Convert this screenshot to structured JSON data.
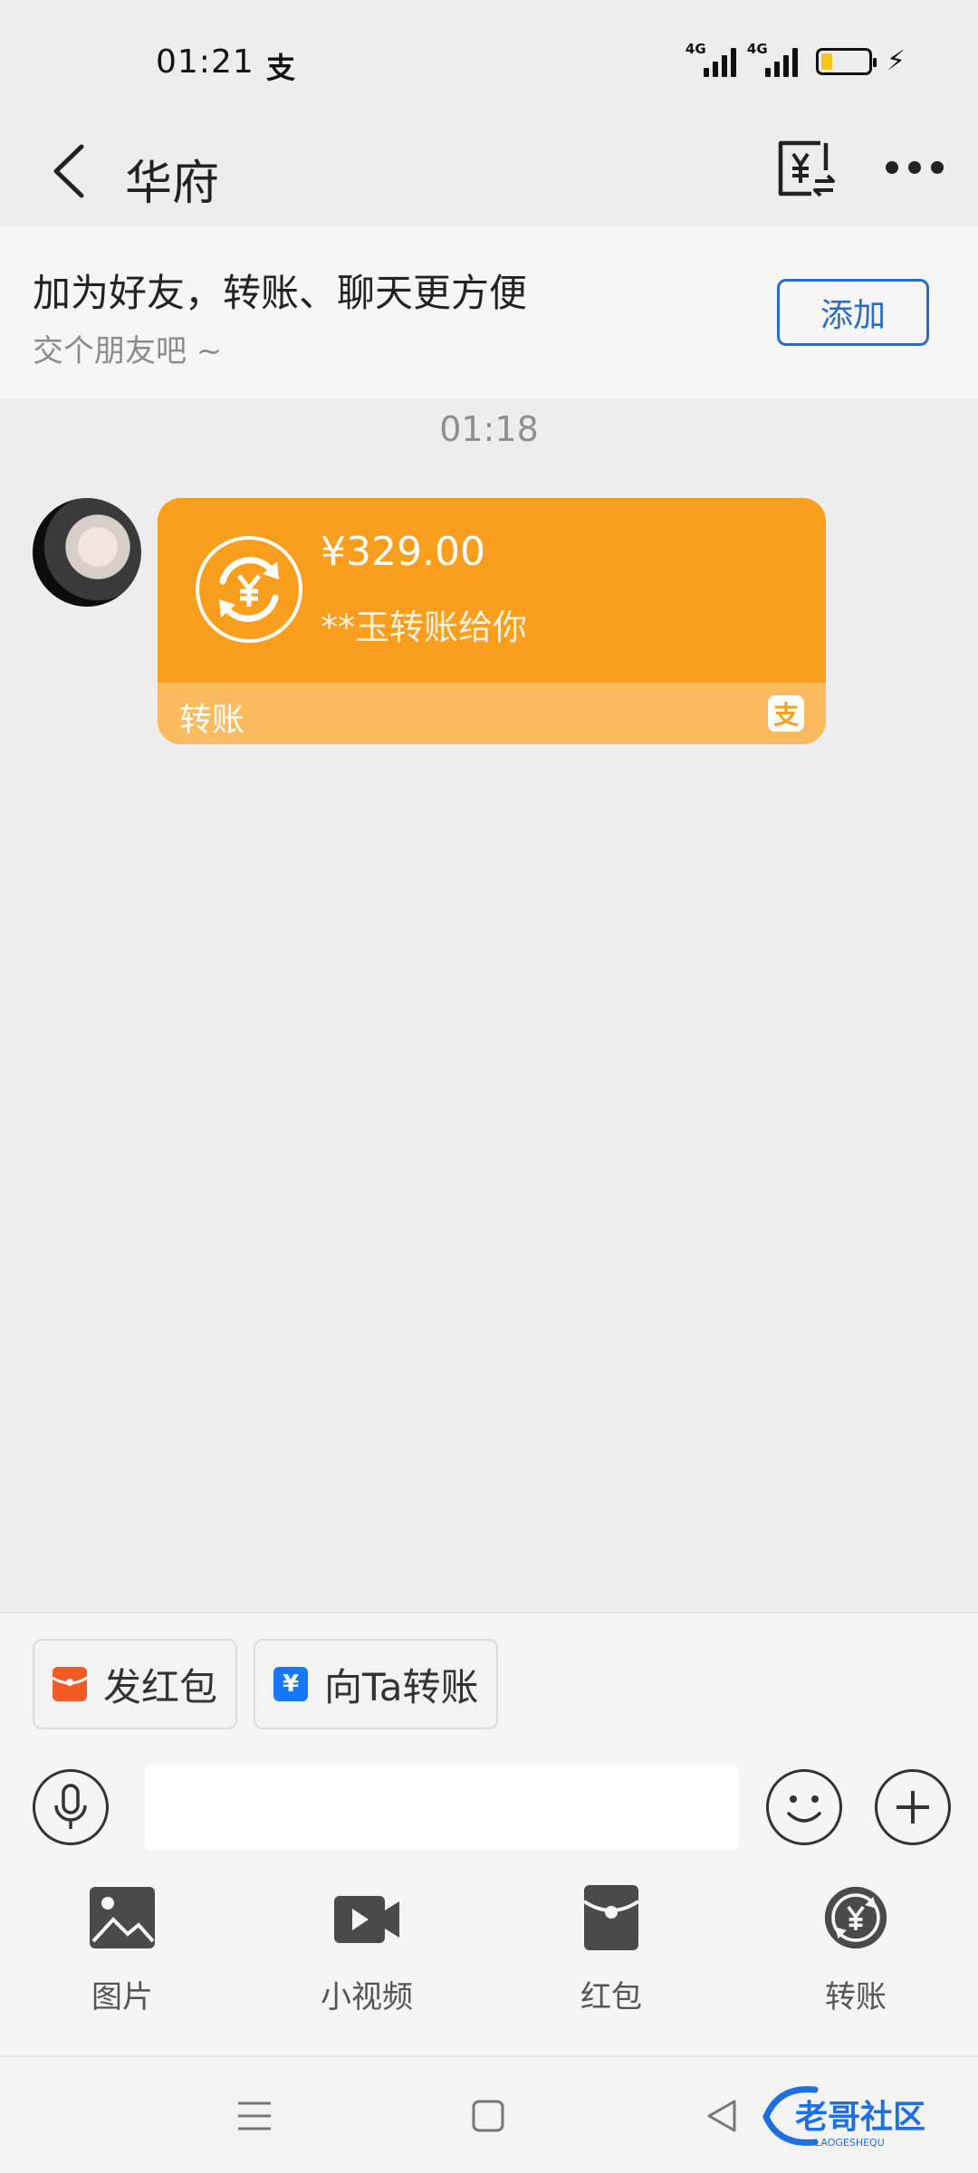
{
  "status_bar": {
    "time": "01:21",
    "app_icon": "支",
    "network_1": "4G",
    "network_2": "4G"
  },
  "nav": {
    "title": "华府",
    "bill_icon": "yuan-bill-icon",
    "more_icon": "more-icon"
  },
  "friend_banner": {
    "title": "加为好友，转账、聊天更方便",
    "subtitle": "交个朋友吧 ~",
    "add_button": "添加"
  },
  "message": {
    "time": "01:18",
    "transfer": {
      "amount": "¥329.00",
      "description": "**玉转账给你",
      "label": "转账",
      "badge": "支"
    }
  },
  "quick_actions": [
    {
      "label": "发红包",
      "icon": "red-packet-icon",
      "glyph": ""
    },
    {
      "label": "向Ta转账",
      "icon": "transfer-card-icon",
      "glyph": "¥"
    }
  ],
  "input": {
    "placeholder": "",
    "value": ""
  },
  "tools": [
    {
      "label": "图片",
      "icon": "image-icon"
    },
    {
      "label": "小视频",
      "icon": "video-icon"
    },
    {
      "label": "红包",
      "icon": "red-packet-icon"
    },
    {
      "label": "转账",
      "icon": "transfer-icon"
    }
  ],
  "watermark": {
    "text": "老哥社区",
    "subtext": "LAOGESHEQU"
  },
  "colors": {
    "transfer_orange": "#fa9e1e",
    "transfer_light": "#fdbb5f",
    "add_blue": "#2c6bc2",
    "background": "#ededed"
  }
}
